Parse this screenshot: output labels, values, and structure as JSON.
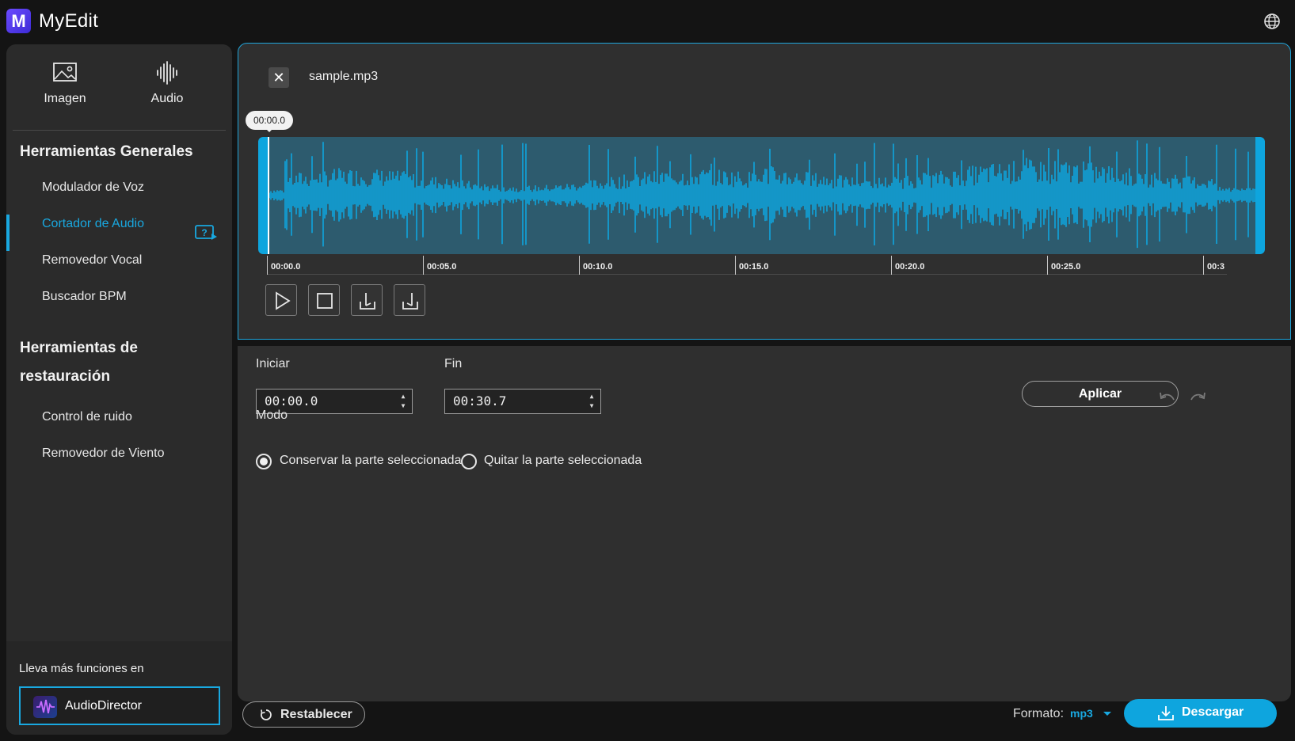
{
  "app": {
    "logo_letter": "M",
    "title": "MyEdit"
  },
  "sidebar": {
    "tabs": [
      {
        "label": "Imagen",
        "icon": "image-icon"
      },
      {
        "label": "Audio",
        "icon": "audio-wave-icon"
      }
    ],
    "sections": [
      {
        "title": "Herramientas Generales",
        "items": [
          "Modulador de Voz",
          "Cortador de Audio",
          "Removedor Vocal",
          "Buscador BPM"
        ]
      },
      {
        "title_line1": "Herramientas de",
        "title_line2": "restauración",
        "items": [
          "Control de ruido",
          "Removedor de Viento"
        ]
      }
    ],
    "active_item": "Cortador de Audio",
    "promo": {
      "text": "Lleva más funciones en",
      "button_label": "AudioDirector"
    }
  },
  "editor": {
    "filename": "sample.mp3",
    "playhead_time": "00:00.0",
    "ruler_ticks": [
      "00:00.0",
      "00:05.0",
      "00:10.0",
      "00:15.0",
      "00:20.0",
      "00:25.0",
      "00:3"
    ],
    "controls": [
      "play-icon",
      "stop-icon",
      "set-start-icon",
      "set-end-icon"
    ]
  },
  "trim": {
    "start_label": "Iniciar",
    "start_value": "00:00.0",
    "end_label": "Fin",
    "end_value": "00:30.7",
    "mode_label": "Modo",
    "options": [
      "Conservar la parte seleccionada",
      "Quitar la parte seleccionada"
    ],
    "selected_option": 0,
    "apply_label": "Aplicar"
  },
  "footer": {
    "reset_label": "Restablecer",
    "format_label": "Formato:",
    "format_value": "mp3",
    "download_label": "Descargar"
  },
  "colors": {
    "accent": "#19a8e0",
    "wave": "#0ea5de",
    "wave_bg": "#2d5b6e",
    "panel": "#2f2f2f",
    "sidebar": "#2b2b2b"
  }
}
